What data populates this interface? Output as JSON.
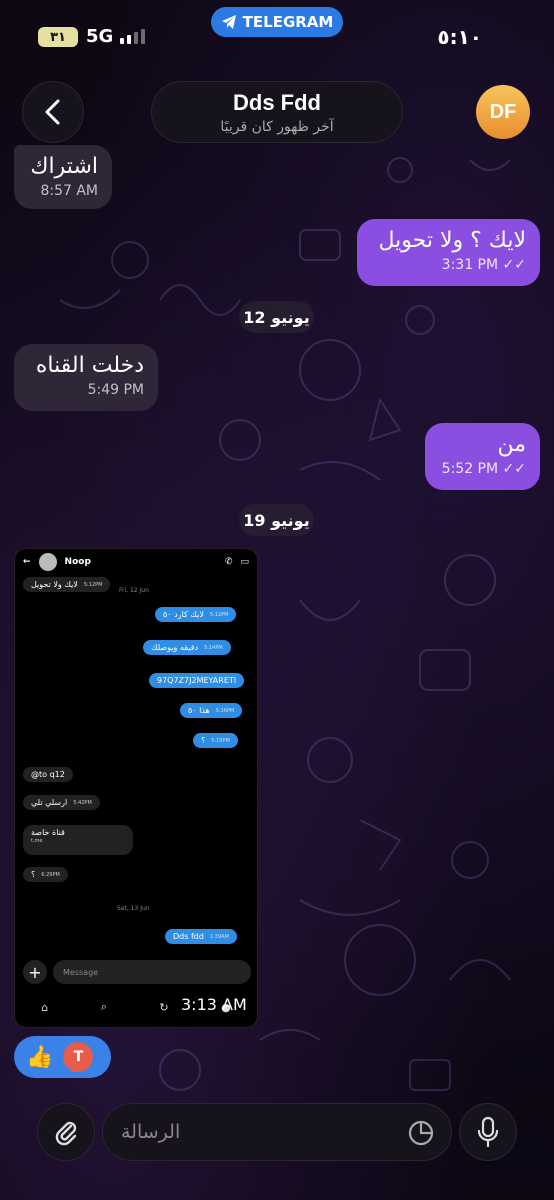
{
  "status_bar": {
    "battery": "٣١",
    "network": "5G",
    "app_pill": "TELEGRAM",
    "time": "٥:١٠"
  },
  "header": {
    "name": "Dds Fdd",
    "last_seen": "آخر ظهور كان قريبًا",
    "avatar_initials": "DF"
  },
  "messages": [
    {
      "dir": "in",
      "text": "اشتراك",
      "time": "8:57 AM"
    },
    {
      "dir": "out",
      "text": "لايك ؟ ولا تحويل",
      "time": "3:31 PM"
    },
    {
      "dir": "in",
      "text": "دخلت القناه",
      "time": "5:49 PM"
    },
    {
      "dir": "out",
      "text": "من",
      "time": "5:52 PM"
    }
  ],
  "dates": [
    "12 يونيو",
    "19 يونيو"
  ],
  "embedded_screenshot": {
    "contact": "Noop",
    "date_1": "Fri, 12 Jun",
    "date_2": "Sat, 13 Jun",
    "messages": [
      {
        "dir": "in",
        "text": "لايك ولا تحويل",
        "time": "5:12PM"
      },
      {
        "dir": "out",
        "text": "لايك كارد ٥٠",
        "time": "5:12PM"
      },
      {
        "dir": "out",
        "text": "دقيقه ويوصلك",
        "time": "5:14PM"
      },
      {
        "dir": "out",
        "text": "97Q7Z7J2MEYARETI",
        "time": ""
      },
      {
        "dir": "out",
        "text": "هذا ٥٠",
        "time": "5:16PM"
      },
      {
        "dir": "out",
        "text": "؟",
        "time": "5:19PM"
      },
      {
        "dir": "in",
        "text": "@to q12",
        "time": ""
      },
      {
        "dir": "in",
        "text": "ارسلي تلي",
        "time": "5:42PM"
      },
      {
        "dir": "in",
        "text": "قناة خاصة",
        "time": "t.me"
      },
      {
        "dir": "in",
        "text": "؟",
        "time": "6:29PM"
      },
      {
        "dir": "out",
        "text": "Dds fdd",
        "time": "1:39AM"
      }
    ],
    "input_placeholder": "Message",
    "overlay_time": "3:13 AM"
  },
  "reactions": {
    "emoji": "👍",
    "user_initial": "T"
  },
  "composer": {
    "placeholder": "الرسالة"
  },
  "colors": {
    "outgoing": "#8a4fe0",
    "incoming": "#2f2637",
    "accent": "#2c7be5"
  }
}
